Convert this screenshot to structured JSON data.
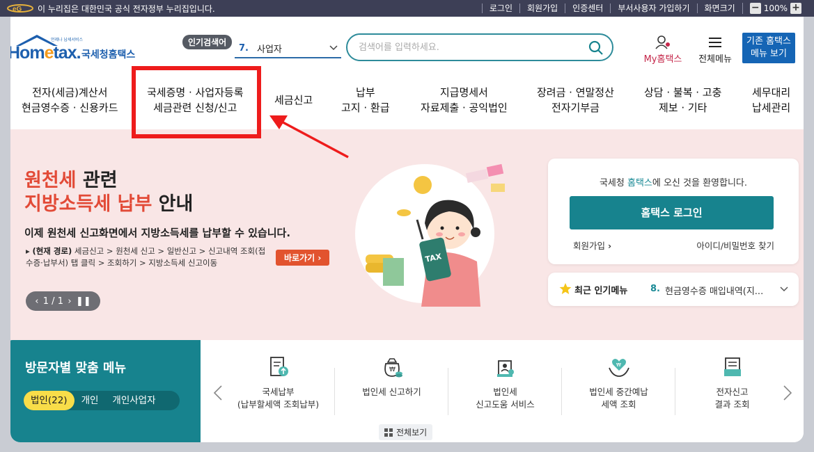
{
  "govbar": {
    "notice": "이 누리집은 대한민국 공식 전자정부 누리집입니다.",
    "links": [
      "로그인",
      "회원가입",
      "인증센터",
      "부서사용자 가입하기",
      "화면크기"
    ],
    "zoom": "100%",
    "zoom_minus": "−",
    "zoom_plus": "+"
  },
  "header": {
    "logo_tag": "언제나 납세서비스",
    "logo_home": "Hom",
    "logo_e": "e",
    "logo_tax": "tax.",
    "logo_kr": "국세청홈택스",
    "popular_badge": "인기검색어",
    "popular_num": "7.",
    "popular_term": "사업자",
    "search_placeholder": "검색어를 입력하세요.",
    "my_hometax": "My홈택스",
    "all_menu": "전체메뉴",
    "old_hometax_l1": "기존 홈택스",
    "old_hometax_l2": "메뉴 보기"
  },
  "nav": [
    {
      "l1": "전자(세금)계산서",
      "l2": "현금영수증 · 신용카드"
    },
    {
      "l1": "국세증명 · 사업자등록",
      "l2": "세금관련 신청/신고"
    },
    {
      "l1": "세금신고",
      "l2": ""
    },
    {
      "l1": "납부",
      "l2": "고지 · 환급"
    },
    {
      "l1": "지급명세서",
      "l2": "자료제출 · 공익법인"
    },
    {
      "l1": "장려금 · 연말정산",
      "l2": "전자기부금"
    },
    {
      "l1": "상담 · 불복 · 고충",
      "l2": "제보 · 기타"
    },
    {
      "l1": "세무대리",
      "l2": "납세관리"
    }
  ],
  "hero": {
    "h1_red": "원천세",
    "h1_rest": " 관련",
    "h2_red": "지방소득세 납부",
    "h2_rest": " 안내",
    "desc": "이제 원천세 신고화면에서 지방소득세를 납부할 수 있습니다.",
    "path_label": "(현재 경로)",
    "path_text": " 세금신고 > 원천세 신고 > 일반신고 > 신고내역 조회(접수증·납부서) 탭 클릭 > 조회하기 > 지방소득세 신고이동",
    "go_button": "바로가기",
    "pager": "1 / 1",
    "tax_label": "TAX"
  },
  "login": {
    "welcome_pre": "국세청 ",
    "welcome_hl": "홈택스",
    "welcome_post": "에 오신 것을 환영합니다.",
    "login_button": "홈택스 로그인",
    "join": "회원가입",
    "find": "아이디/비밀번호 찾기"
  },
  "popular_menu": {
    "title": "최근 인기메뉴",
    "num": "8.",
    "value": "현금영수증 매입내역(지..."
  },
  "visitor": {
    "title": "방문자별 맞춤 메뉴",
    "tabs": [
      "법인(22)",
      "개인",
      "개인사업자"
    ]
  },
  "services": [
    {
      "l1": "국세납부",
      "l2": "(납부할세액 조회납부)",
      "icon": "tax-payment-icon"
    },
    {
      "l1": "법인세 신고하기",
      "l2": "",
      "icon": "corporate-tax-filing-icon"
    },
    {
      "l1": "법인세",
      "l2": "신고도움 서비스",
      "icon": "filing-help-icon"
    },
    {
      "l1": "법인세 중간예납",
      "l2": "세액 조회",
      "icon": "interim-prepayment-icon"
    },
    {
      "l1": "전자신고",
      "l2": "결과 조회",
      "icon": "e-filing-result-icon"
    }
  ],
  "view_all": "전체보기",
  "colors": {
    "gov_bar": "#3d3f56",
    "brand_blue": "#1d5fae",
    "teal": "#17838e",
    "hero_bg": "#f9e6e6",
    "accent_red": "#e24a37",
    "highlight_red": "#ee1c1c"
  }
}
